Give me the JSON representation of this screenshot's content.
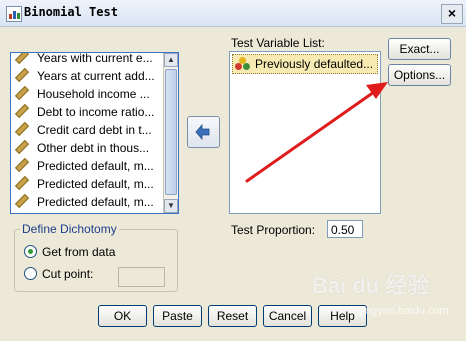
{
  "window": {
    "title": "Binomial Test",
    "close_glyph": "×"
  },
  "source_list": {
    "items": [
      "Years with current e...",
      "Years at current add...",
      "Household income ...",
      "Debt to income ratio...",
      "Credit card debt in t...",
      "Other debt in thous...",
      "Predicted default, m...",
      "Predicted default, m...",
      "Predicted default, m..."
    ],
    "item_icon": "scale-ruler-icon"
  },
  "move_button": {
    "icon": "arrow-left-icon"
  },
  "test_variable_list": {
    "label": "Test Variable List:",
    "items": [
      "Previously defaulted..."
    ],
    "item_icon": "nominal-variable-icon"
  },
  "side_buttons": {
    "exact": "Exact...",
    "options": "Options..."
  },
  "test_proportion": {
    "label": "Test Proportion:",
    "value": "0.50"
  },
  "define_dichotomy": {
    "title": "Define Dichotomy",
    "get_from_data": "Get from data",
    "cut_point": "Cut point:",
    "selected": "get_from_data",
    "cut_point_value": ""
  },
  "bottom_buttons": {
    "ok": "OK",
    "paste": "Paste",
    "reset": "Reset",
    "cancel": "Cancel",
    "help": "Help"
  },
  "watermark": {
    "brand": "Bai du 经验",
    "url": "jingyan.baidu.com"
  },
  "colors": {
    "annotation_arrow": "#e01b1b",
    "list_border": "#3a73c4",
    "selected_item_bg": "#f7eab2"
  }
}
